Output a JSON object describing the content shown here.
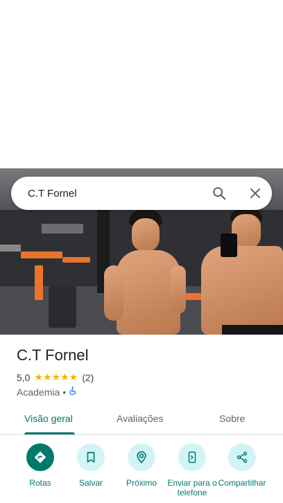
{
  "search": {
    "query": "C.T Fornel"
  },
  "place": {
    "name": "C.T Fornel",
    "rating": "5,0",
    "stars": "★★★★★",
    "review_count": "(2)",
    "category": "Academia",
    "separator": "•"
  },
  "tabs": [
    {
      "label": "Visão geral",
      "active": true
    },
    {
      "label": "Avaliações",
      "active": false
    },
    {
      "label": "Sobre",
      "active": false
    }
  ],
  "actions": [
    {
      "label": "Rotas",
      "icon": "directions-icon"
    },
    {
      "label": "Salvar",
      "icon": "bookmark-icon"
    },
    {
      "label": "Próximo",
      "icon": "nearby-icon"
    },
    {
      "label": "Enviar para o telefone",
      "icon": "send-to-phone-icon"
    },
    {
      "label": "Compartilhar",
      "icon": "share-icon"
    }
  ],
  "colors": {
    "accent": "#00796b",
    "action_bg": "#d3f4f6",
    "star": "#f4b400",
    "accessibility": "#1a73e8"
  }
}
